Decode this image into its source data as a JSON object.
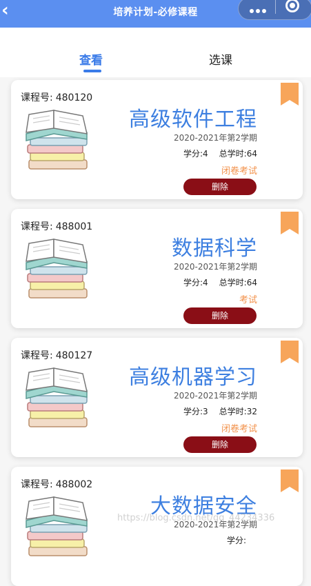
{
  "navbar": {
    "back_icon": "chevron-left-icon",
    "title": "培养计划-必修课程",
    "capsule_more_icon": "more-dots-icon",
    "capsule_close_icon": "target-circle-icon",
    "color": "#5b8ff0"
  },
  "tabs": [
    {
      "label": "查看",
      "active": true
    },
    {
      "label": "选课",
      "active": false
    }
  ],
  "course_id_label": "课程号:",
  "courses": [
    {
      "id": "480120",
      "name": "高级软件工程",
      "term": "2020-2021年第2学期",
      "credits_label": "学分:",
      "credits": "4",
      "hours_label": "总学时:",
      "hours": "64",
      "exam": "闭卷考试",
      "delete_label": "删除"
    },
    {
      "id": "488001",
      "name": "数据科学",
      "term": "2020-2021年第2学期",
      "credits_label": "学分:",
      "credits": "4",
      "hours_label": "总学时:",
      "hours": "64",
      "exam": "考试",
      "delete_label": "删除"
    },
    {
      "id": "480127",
      "name": "高级机器学习",
      "term": "2020-2021年第2学期",
      "credits_label": "学分:",
      "credits": "3",
      "hours_label": "总学时:",
      "hours": "32",
      "exam": "闭卷考试",
      "delete_label": "删除"
    },
    {
      "id": "488002",
      "name": "大数据安全",
      "term": "2020-2021年第2学期",
      "credits_label": "学分:",
      "credits": "",
      "hours_label": "",
      "hours": "",
      "exam": "",
      "delete_label": ""
    }
  ],
  "watermark": "https://blog.csdn.net/qq_44234336",
  "colors": {
    "accent": "#3a7be8",
    "delete": "#8a0e16",
    "exam": "#f2914a",
    "bookmark": "#f7a55a"
  }
}
